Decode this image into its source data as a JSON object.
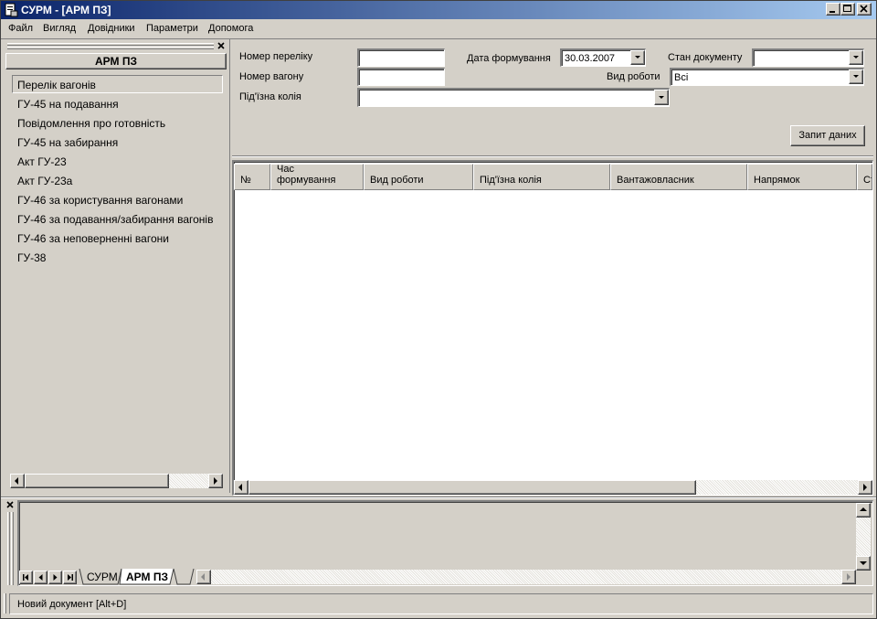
{
  "window": {
    "title": "СУРМ -  [АРМ ПЗ]"
  },
  "menu": [
    "Файл",
    "Вигляд",
    "Довідники",
    "Параметри",
    "Допомога"
  ],
  "left_panel": {
    "header": "АРМ ПЗ",
    "items": [
      "Перелік вагонів",
      "ГУ-45 на подавання",
      "Повідомлення про готовність",
      "ГУ-45 на забирання",
      "Акт ГУ-23",
      "Акт ГУ-23а",
      "ГУ-46 за користування вагонами",
      "ГУ-46 за подавання/забирання вагонів",
      "ГУ-46 за неповерненні вагони",
      "ГУ-38"
    ]
  },
  "filters": {
    "list_number_label": "Номер переліку",
    "list_number_value": "",
    "wagon_number_label": "Номер вагону",
    "wagon_number_value": "",
    "siding_label": "Під'їзна колія",
    "siding_value": "",
    "date_label": "Дата формування",
    "date_value": "30.03.2007",
    "work_type_label": "Вид роботи",
    "work_type_value": "Всі",
    "doc_state_label": "Стан документу",
    "doc_state_value": "",
    "query_button": "Запит даних"
  },
  "grid": {
    "columns": [
      "№",
      "Час формування",
      "Вид роботи",
      "Під'їзна колія",
      "Вантажовласник",
      "Напрямок",
      "Ст"
    ]
  },
  "tabs": [
    "СУРМ",
    "АРМ ПЗ"
  ],
  "status": {
    "text": "Новий документ [Alt+D]"
  },
  "colors": {
    "face": "#d4d0c8",
    "title_start": "#0a246a",
    "title_end": "#a6caf0",
    "shadow": "#808080"
  }
}
